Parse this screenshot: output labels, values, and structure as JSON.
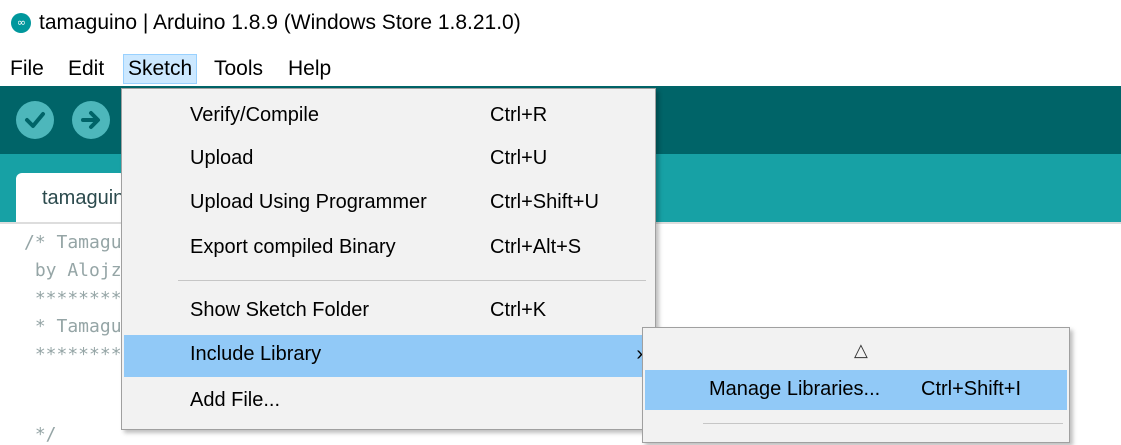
{
  "window": {
    "title": "tamaguino | Arduino 1.8.9 (Windows Store 1.8.21.0)",
    "logo_glyph": "∞",
    "logo_icon": "arduino-logo-icon"
  },
  "menubar": {
    "items": [
      {
        "label": "File"
      },
      {
        "label": "Edit"
      },
      {
        "label": "Sketch"
      },
      {
        "label": "Tools"
      },
      {
        "label": "Help"
      }
    ]
  },
  "toolbar": {
    "verify_icon": "check-icon",
    "upload_icon": "arrow-right-icon"
  },
  "tabs": [
    {
      "label": "tamaguino"
    }
  ],
  "editor": {
    "lines": [
      "/* Tamaguino",
      " by Alojz Jakob",
      " *************************",
      " * Tamaguino",
      " *************************",
      "",
      " */"
    ]
  },
  "sketch_menu": {
    "items": [
      {
        "label": "Verify/Compile",
        "shortcut": "Ctrl+R"
      },
      {
        "label": "Upload",
        "shortcut": "Ctrl+U"
      },
      {
        "label": "Upload Using Programmer",
        "shortcut": "Ctrl+Shift+U"
      },
      {
        "label": "Export compiled Binary",
        "shortcut": "Ctrl+Alt+S"
      },
      {
        "label": "Show Sketch Folder",
        "shortcut": "Ctrl+K"
      },
      {
        "label": "Include Library",
        "arrow": "›"
      },
      {
        "label": "Add File..."
      }
    ]
  },
  "include_library_submenu": {
    "scroll_up_glyph": "△",
    "items": [
      {
        "label": "Manage Libraries...",
        "shortcut": "Ctrl+Shift+I"
      }
    ]
  },
  "colors": {
    "toolbar": "#006468",
    "tabbar": "#17a1a5",
    "highlight": "#91c9f7"
  }
}
